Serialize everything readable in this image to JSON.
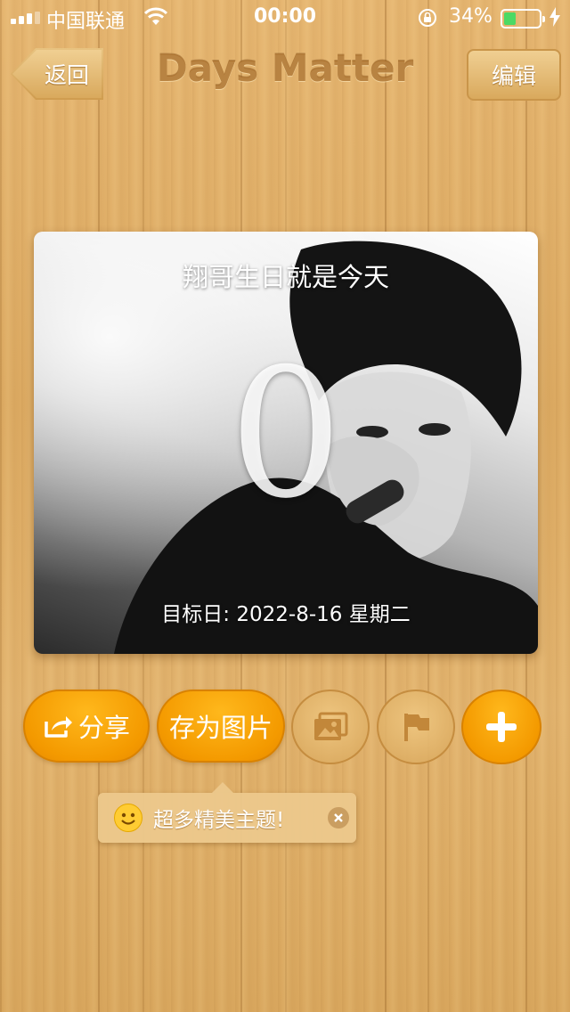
{
  "status_bar": {
    "carrier": "中国联通",
    "time": "00:00",
    "battery_percent": "34%",
    "battery_level": 0.34,
    "icons": [
      "signal-icon",
      "wifi-icon",
      "rotation-lock-icon",
      "battery-icon",
      "charging-bolt-icon"
    ]
  },
  "nav": {
    "back_label": "返回",
    "title": "Days Matter",
    "edit_label": "编辑"
  },
  "card": {
    "title": "翔哥生日就是今天",
    "days": "0",
    "target_date": "目标日: 2022-8-16 星期二"
  },
  "actions": {
    "share_label": "分享",
    "save_image_label": "存为图片",
    "theme_icon": "image-gallery-icon",
    "flag_icon": "flag-icon",
    "add_icon": "plus-icon"
  },
  "tip": {
    "text": "超多精美主题!",
    "icon": "smile-emoji-icon"
  },
  "colors": {
    "accent_orange": "#f49a00",
    "wood": "#e2b36e"
  }
}
